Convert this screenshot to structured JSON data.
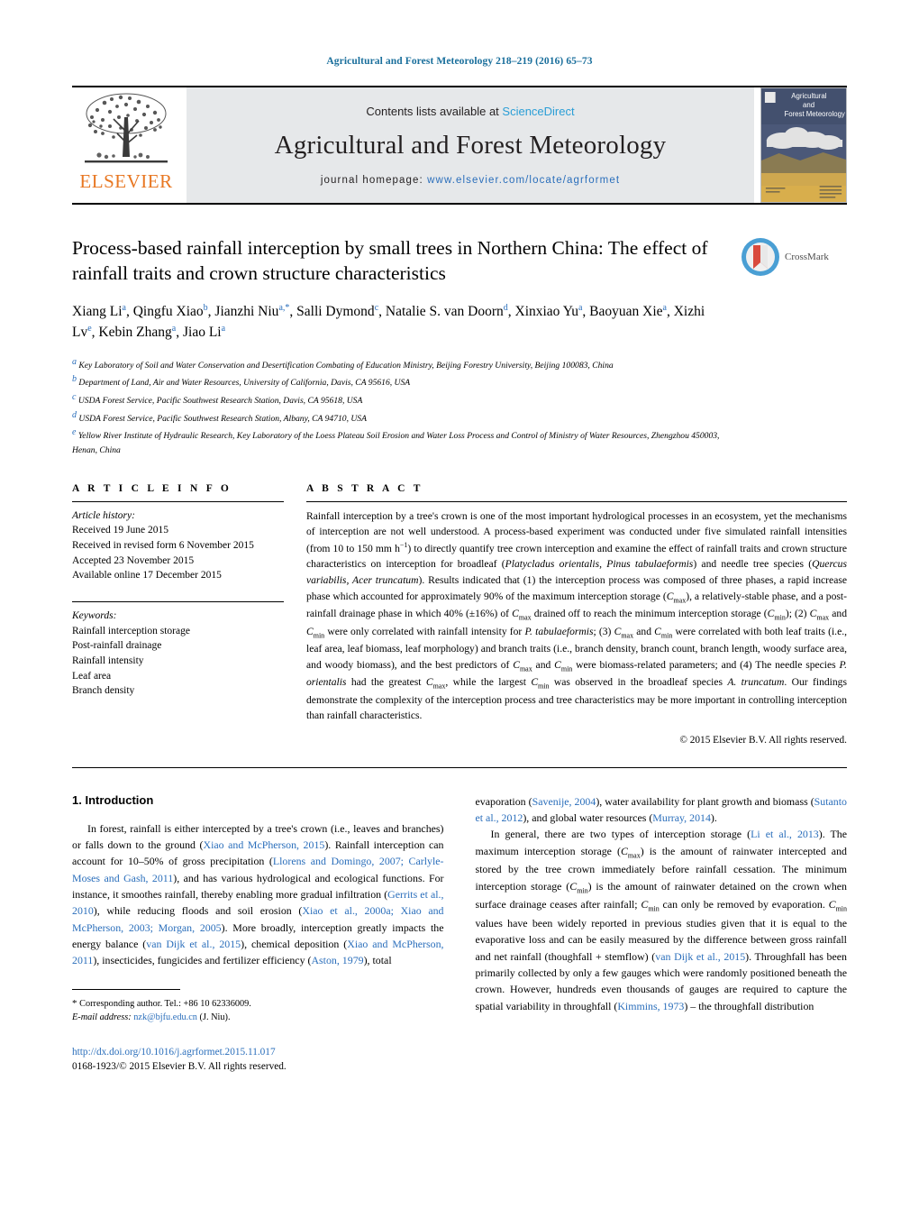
{
  "running_head": "Agricultural and Forest Meteorology 218–219 (2016) 65–73",
  "masthead": {
    "contents_prefix": "Contents lists available at ",
    "sciencedirect": "ScienceDirect",
    "journal_title": "Agricultural and Forest Meteorology",
    "homepage_prefix": "journal homepage: ",
    "homepage_url": "www.elsevier.com/locate/agrformet",
    "publisher": "ELSEVIER",
    "cover_title_lines": [
      "Agricultural",
      "and",
      "Forest Meteorology"
    ],
    "accent_blue": "#2a9ed6",
    "link_blue": "#2a6ebb",
    "elsevier_orange": "#E87722",
    "band_gray": "#e6e8ea"
  },
  "title": "Process-based rainfall interception by small trees in Northern China: The effect of rainfall traits and crown structure characteristics",
  "crossmark_label": "CrossMark",
  "authors_html": "Xiang Li<sup>a</sup>, Qingfu Xiao<sup>b</sup>, Jianzhi Niu<sup>a,*</sup>, Salli Dymond<sup>c</sup>, Natalie S. van Doorn<sup>d</sup>, Xinxiao Yu<sup>a</sup>, Baoyuan Xie<sup>a</sup>, Xizhi Lv<sup>e</sup>, Kebin Zhang<sup>a</sup>, Jiao Li<sup>a</sup>",
  "affiliations": [
    {
      "marker": "a",
      "text": "Key Laboratory of Soil and Water Conservation and Desertification Combating of Education Ministry, Beijing Forestry University, Beijing 100083, China"
    },
    {
      "marker": "b",
      "text": "Department of Land, Air and Water Resources, University of California, Davis, CA 95616, USA"
    },
    {
      "marker": "c",
      "text": "USDA Forest Service, Pacific Southwest Research Station, Davis, CA 95618, USA"
    },
    {
      "marker": "d",
      "text": "USDA Forest Service, Pacific Southwest Research Station, Albany, CA 94710, USA"
    },
    {
      "marker": "e",
      "text": "Yellow River Institute of Hydraulic Research, Key Laboratory of the Loess Plateau Soil Erosion and Water Loss Process and Control of Ministry of Water Resources, Zhengzhou 450003, Henan, China"
    }
  ],
  "article_info": {
    "heading": "A R T I C L E   I N F O",
    "history_label": "Article history:",
    "history": [
      "Received 19 June 2015",
      "Received in revised form 6 November 2015",
      "Accepted 23 November 2015",
      "Available online 17 December 2015"
    ],
    "keywords_label": "Keywords:",
    "keywords": [
      "Rainfall interception storage",
      "Post-rainfall drainage",
      "Rainfall intensity",
      "Leaf area",
      "Branch density"
    ]
  },
  "abstract": {
    "heading": "A B S T R A C T",
    "html": "Rainfall interception by a tree's crown is one of the most important hydrological processes in an ecosystem, yet the mechanisms of interception are not well understood. A process-based experiment was conducted under five simulated rainfall intensities (from 10 to 150 mm h<sup>−1</sup>) to directly quantify tree crown interception and examine the effect of rainfall traits and crown structure characteristics on interception for broadleaf (<i>Platycladus orientalis, Pinus tabulaeformis</i>) and needle tree species (<i>Quercus variabilis, Acer truncatum</i>). Results indicated that (1) the interception process was composed of three phases, a rapid increase phase which accounted for approximately 90% of the maximum interception storage (<i>C</i><sub>max</sub>), a relatively-stable phase, and a post-rainfall drainage phase in which 40% (±16%) of <i>C</i><sub>max</sub> drained off to reach the minimum interception storage (<i>C</i><sub>min</sub>); (2) <i>C</i><sub>max</sub> and <i>C</i><sub>min</sub> were only correlated with rainfall intensity for <i>P. tabulaeformis</i>; (3) <i>C</i><sub>max</sub> and <i>C</i><sub>min</sub> were correlated with both leaf traits (i.e., leaf area, leaf biomass, leaf morphology) and branch traits (i.e., branch density, branch count, branch length, woody surface area, and woody biomass), and the best predictors of <i>C</i><sub>max</sub> and <i>C</i><sub>min</sub> were biomass-related parameters; and (4) The needle species <i>P. orientalis</i> had the greatest <i>C</i><sub>max</sub>, while the largest <i>C</i><sub>min</sub> was observed in the broadleaf species <i>A. truncatum</i>. Our findings demonstrate the complexity of the interception process and tree characteristics may be more important in controlling interception than rainfall characteristics.",
    "copyright": "© 2015 Elsevier B.V. All rights reserved."
  },
  "body": {
    "section_heading": "1.  Introduction",
    "left_paragraph_html": "In forest, rainfall is either intercepted by a tree's crown (i.e., leaves and branches) or falls down to the ground (<span class=\"ref\">Xiao and McPherson, 2015</span>). Rainfall interception can account for 10–50% of gross precipitation (<span class=\"ref\">Llorens and Domingo, 2007; Carlyle-Moses and Gash, 2011</span>), and has various hydrological and ecological functions. For instance, it smoothes rainfall, thereby enabling more gradual infiltration (<span class=\"ref\">Gerrits et al., 2010</span>), while reducing floods and soil erosion (<span class=\"ref\">Xiao et al., 2000a; Xiao and McPherson, 2003; Morgan, 2005</span>). More broadly, interception greatly impacts the energy balance (<span class=\"ref\">van Dijk et al., 2015</span>), chemical deposition (<span class=\"ref\">Xiao and McPherson, 2011</span>), insecticides, fungicides and fertilizer efficiency (<span class=\"ref\">Aston, 1979</span>), total",
    "right_paragraph_1_html": "evaporation (<span class=\"ref\">Savenije, 2004</span>), water availability for plant growth and biomass (<span class=\"ref\">Sutanto et al., 2012</span>), and global water resources (<span class=\"ref\">Murray, 2014</span>).",
    "right_paragraph_2_html": "In general, there are two types of interception storage (<span class=\"ref\">Li et al., 2013</span>). The maximum interception storage (<i>C</i><sub>max</sub>) is the amount of rainwater intercepted and stored by the tree crown immediately before rainfall cessation. The minimum interception storage (<i>C</i><sub>min</sub>) is the amount of rainwater detained on the crown when surface drainage ceases after rainfall; <i>C</i><sub>min</sub> can only be removed by evaporation. <i>C</i><sub>min</sub> values have been widely reported in previous studies given that it is equal to the evaporative loss and can be easily measured by the difference between gross rainfall and net rainfall (thoughfall + stemflow) (<span class=\"ref\">van Dijk et al., 2015</span>). Throughfall has been primarily collected by only a few gauges which were randomly positioned beneath the crown. However, hundreds even thousands of gauges are required to capture the spatial variability in throughfall (<span class=\"ref\">Kimmins, 1973</span>) – the throughfall distribution"
  },
  "footer": {
    "corresponding_html": "<span class=\"star\">*</span>  Corresponding author. Tel.: +86 10 62336009.",
    "email_label": "E-mail address:",
    "email": "nzk@bjfu.edu.cn",
    "email_suffix": "(J. Niu).",
    "doi": "http://dx.doi.org/10.1016/j.agrformet.2015.11.017",
    "issn_line": "0168-1923/© 2015 Elsevier B.V. All rights reserved."
  }
}
